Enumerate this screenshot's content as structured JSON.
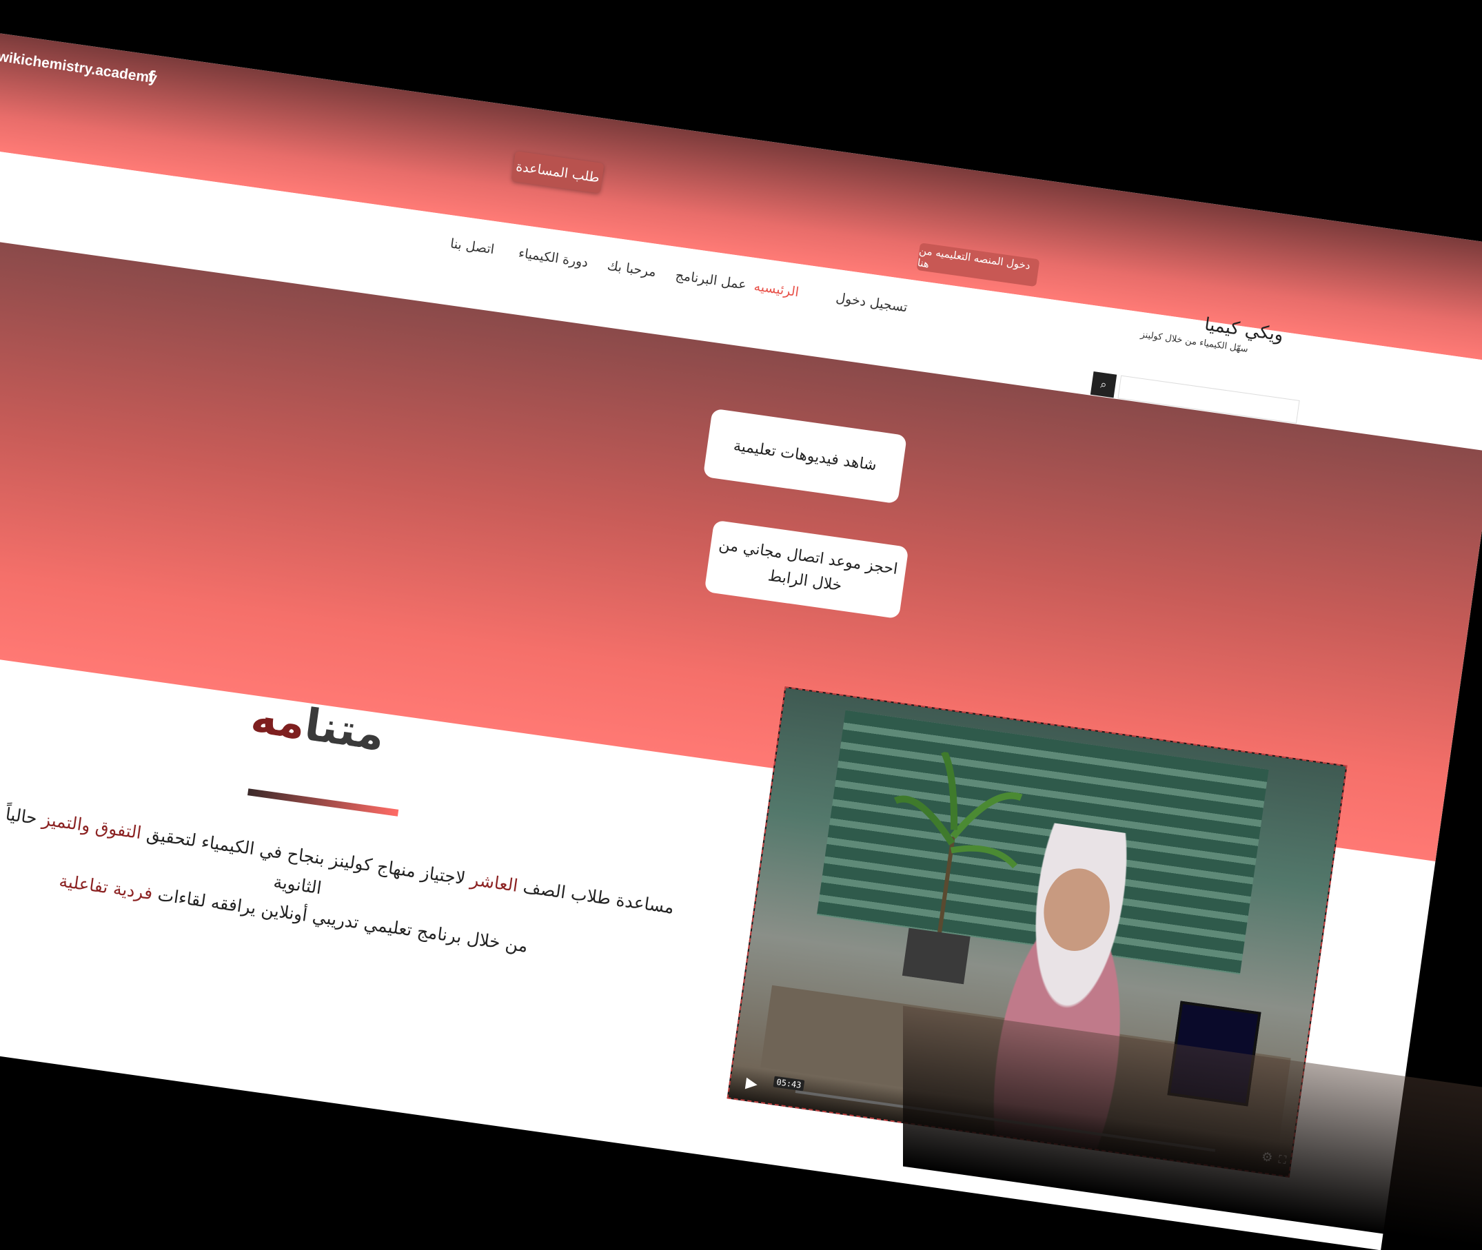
{
  "header": {
    "domain": "wikichemistry.academy",
    "facebook_icon": "f",
    "help_button": "طلب المساعدة",
    "platform_login": "دخول المنصه التعليميه من هنا"
  },
  "nav": {
    "items": [
      {
        "label": "تسجيل دخول",
        "active": false
      },
      {
        "label": "الرئيسيه",
        "active": true
      },
      {
        "label": "عمل البرنامج",
        "active": false
      },
      {
        "label": "مرحبا بك",
        "active": false
      },
      {
        "label": "دورة الكيمياء",
        "active": false
      },
      {
        "label": "اتصل بنا",
        "active": false
      }
    ],
    "search_icon": "⌕"
  },
  "brand": {
    "name": "ويكي كيميا",
    "tagline": "سهّل الكيمياء من خلال كولينز"
  },
  "hero": {
    "watch_videos": "شاهد فيديوهات تعليمية",
    "book_call": "احجز موعد اتصال مجاني من خلال الرابط"
  },
  "mission": {
    "title_dark": "متنا",
    "title_accent": "مه",
    "line1_part1": "مساعدة طلاب الصف ",
    "line1_hl1": "العاشر",
    "line1_part2": " لاجتياز منهاج كولينز بنجاح في الكيمياء لتحقيق ",
    "line1_hl2": "التفوق والتميز",
    "line1_part3": " حالياً وبالمراحل الثانوية",
    "line2_part1": "من خلال برنامج تعليمي تدريبي أونلاين يرافقه لقاءات ",
    "line2_hl": "فردية تفاعلية"
  },
  "video": {
    "time": "05:43",
    "play_icon": "▶",
    "settings_icon": "⚙",
    "fullscreen_icon": "⛶"
  },
  "colors": {
    "accent": "#e8524a",
    "hero_start": "#8a4a4a",
    "hero_end": "#ff7974",
    "highlight": "#8c2323"
  }
}
